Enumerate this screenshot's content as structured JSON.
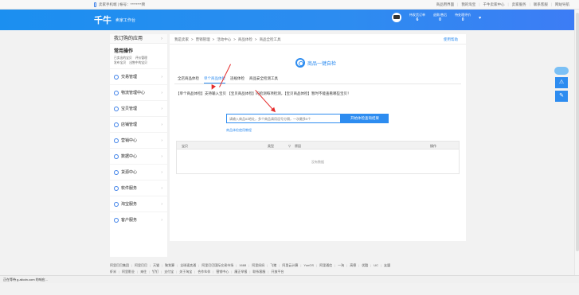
{
  "topbar": {
    "left_text": "卖家手机端 | 帐号：********牌",
    "links": [
      "商品用界面",
      "我的淘宝",
      "千牛卖家中心",
      "卖家服务",
      "联系客服",
      "网站导航"
    ]
  },
  "header": {
    "logo": "千牛",
    "subtitle": "卖家工作台",
    "stats": [
      {
        "label": "待发货订单",
        "value": "6"
      },
      {
        "label": "退款/售后",
        "value": "0"
      },
      {
        "label": "待处理评价",
        "value": "0"
      }
    ]
  },
  "sidebar": {
    "head": "我订购的应用",
    "common_title": "常用操作",
    "common_rows": [
      [
        "已卖出的宝贝",
        "评价管理"
      ],
      [
        "发布宝贝",
        "出售中的宝贝"
      ]
    ],
    "items": [
      "交易管理",
      "物流管理中心",
      "宝贝管理",
      "店铺管理",
      "营销中心",
      "数据中心",
      "货源中心",
      "软件服务",
      "淘宝服务",
      "客户服务"
    ]
  },
  "main": {
    "breadcrumb": [
      "我是卖家",
      "营销管理",
      "活动中心",
      "商品体检",
      "商品全检工具"
    ],
    "help": "使用帮助",
    "brand": "商品一键自检",
    "tabs": [
      "全店商品体检",
      "单个商品体检",
      "违规体检",
      "商品安全检测工具"
    ],
    "active_tab": 1,
    "notice": "【单个商品体检】支持输入宝贝 【宝贝商品体检】的检测每项检测，【宝贝商品体检】暂时不能查看哪些宝贝！",
    "input_placeholder": "请输入商品ID地址，多个商品请用逗号分隔，一次最多5个",
    "start_button": "开始体检查询结果",
    "tutorial": "商品体检使用教程",
    "table": {
      "headers": [
        "宝贝",
        "类型",
        "原因",
        "操作"
      ],
      "empty": "没有数据"
    }
  },
  "footer": {
    "row1": [
      "阿里巴巴集团",
      "阿里巴巴",
      "天猫",
      "聚划算",
      "全球速卖通",
      "阿里巴巴国际交易市场",
      "1688",
      "阿里妈妈",
      "飞猪",
      "阿里云计算",
      "YunOS",
      "阿里通信",
      "一淘",
      "高德",
      "优酷",
      "UC",
      "友盟"
    ],
    "row2": [
      "虾米",
      "阿里影业",
      "来往",
      "钉钉",
      "支付宝",
      "关于淘宝",
      "合作伙伴",
      "营销中心",
      "廉正举报",
      "联系客服",
      "开放平台"
    ]
  },
  "status": {
    "text": "正在等待 g.alicdn.com 的响应..."
  },
  "colors": {
    "accent": "#2d8cf0",
    "arrow": "#e52b2b"
  }
}
